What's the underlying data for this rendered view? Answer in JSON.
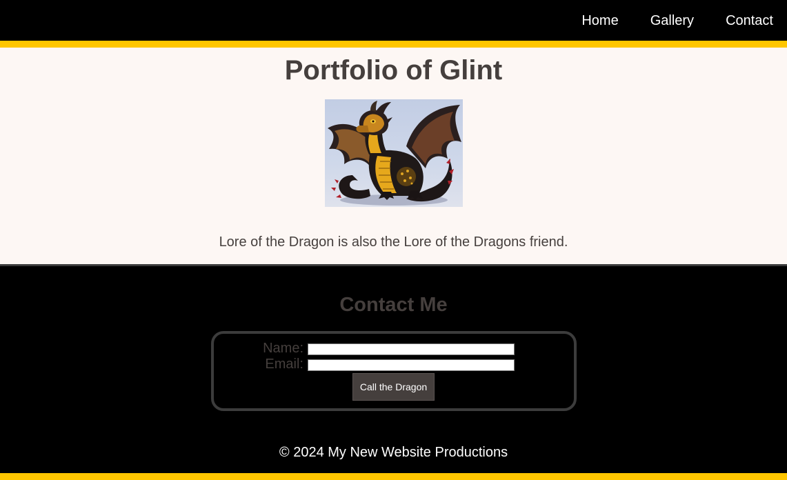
{
  "nav": {
    "items": [
      {
        "label": "Home"
      },
      {
        "label": "Gallery"
      },
      {
        "label": "Contact"
      }
    ]
  },
  "portfolio": {
    "title": "Portfolio of Glint",
    "image_subject": "dragon-illustration",
    "caption": "Lore of the Dragon is also the Lore of the Dragons friend."
  },
  "contact": {
    "heading": "Contact Me",
    "name_label": "Name:",
    "name_value": "",
    "email_label": "Email:",
    "email_value": "",
    "submit_label": "Call the Dragon"
  },
  "footer": {
    "text": "© 2024 My New Website Productions"
  },
  "colors": {
    "accent": "#ffc600",
    "header_bg": "#000000",
    "content_bg": "#fdf7f4",
    "text_dark": "#453f3d",
    "button_bg": "#453f3d"
  }
}
